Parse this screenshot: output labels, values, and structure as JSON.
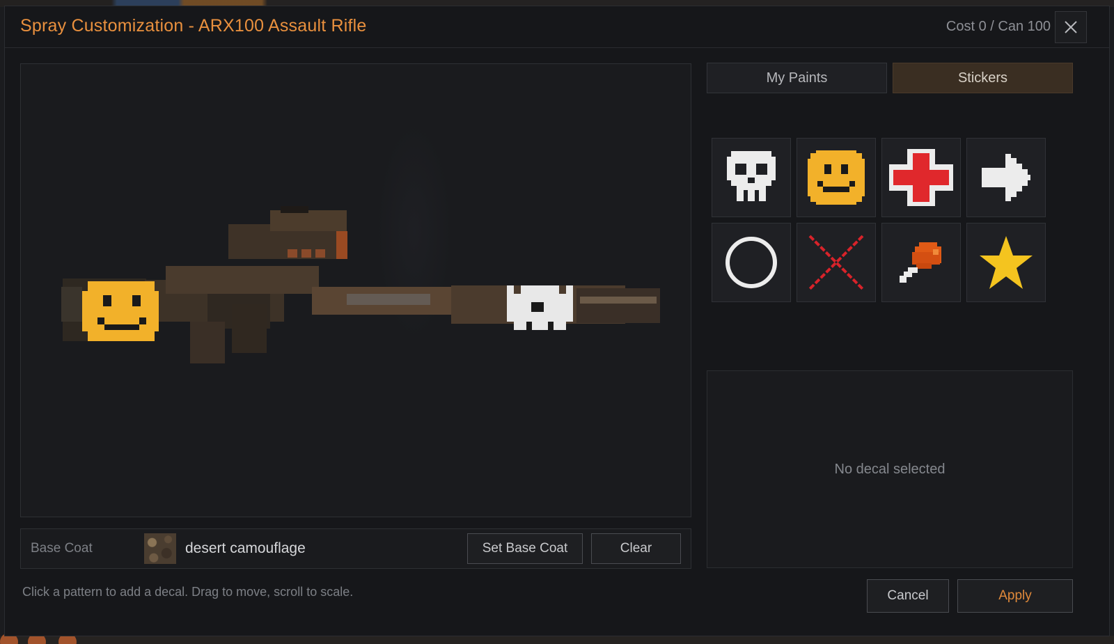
{
  "dialog": {
    "title": "Spray Customization - ARX100 Assault Rifle",
    "cost_text": "Cost 0 / Can 100",
    "close_icon": "close-icon"
  },
  "tabs": [
    {
      "label": "My Paints",
      "selected": false
    },
    {
      "label": "Stickers",
      "selected": true
    }
  ],
  "stickers": [
    {
      "name": "skull-icon"
    },
    {
      "name": "smiley-icon"
    },
    {
      "name": "medical-cross-icon"
    },
    {
      "name": "arrow-right-icon"
    },
    {
      "name": "circle-icon"
    },
    {
      "name": "x-mark-icon"
    },
    {
      "name": "chicken-leg-icon"
    },
    {
      "name": "star-icon"
    }
  ],
  "base_coat": {
    "label": "Base Coat",
    "pattern_name": "desert camouflage",
    "set_button": "Set Base Coat",
    "clear_button": "Clear"
  },
  "details": {
    "empty_text": "No decal selected"
  },
  "hint": "Click a pattern to add a decal. Drag to move, scroll to scale.",
  "actions": {
    "cancel": "Cancel",
    "apply": "Apply"
  },
  "colors": {
    "accent": "#e9903e",
    "selected_tab": "#3a2e22"
  }
}
